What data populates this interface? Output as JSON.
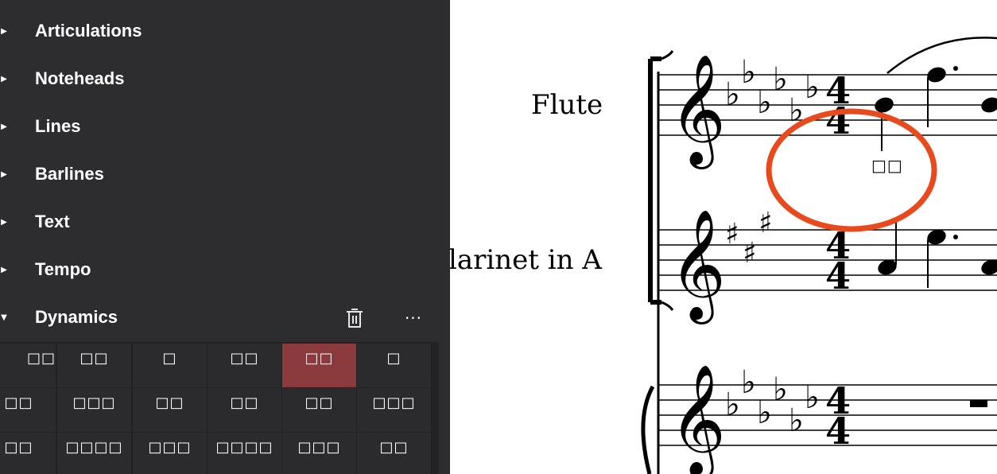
{
  "palette": {
    "sections": [
      {
        "label": "Articulations",
        "expanded": false
      },
      {
        "label": "Noteheads",
        "expanded": false
      },
      {
        "label": "Lines",
        "expanded": false
      },
      {
        "label": "Barlines",
        "expanded": false
      },
      {
        "label": "Text",
        "expanded": false
      },
      {
        "label": "Tempo",
        "expanded": false
      },
      {
        "label": "Dynamics",
        "expanded": true
      }
    ],
    "collapsed_glyph": "▶",
    "expanded_glyph": "▼",
    "more_glyph": "···",
    "dynamics_cells": [
      [
        "□□",
        "□□",
        "□",
        "□□",
        "□□",
        "□"
      ],
      [
        "□□",
        "□□□",
        "□□",
        "□□",
        "□□",
        "□□□"
      ],
      [
        "□□",
        "□□□□",
        "□□□",
        "□□□□",
        "□□□",
        "□□"
      ]
    ],
    "selected_cell": [
      0,
      4
    ]
  },
  "score": {
    "instruments": [
      "Flute",
      "Clarinet in A"
    ],
    "missing_glyph_label": "□□",
    "highlight_color": "#e8491d"
  }
}
